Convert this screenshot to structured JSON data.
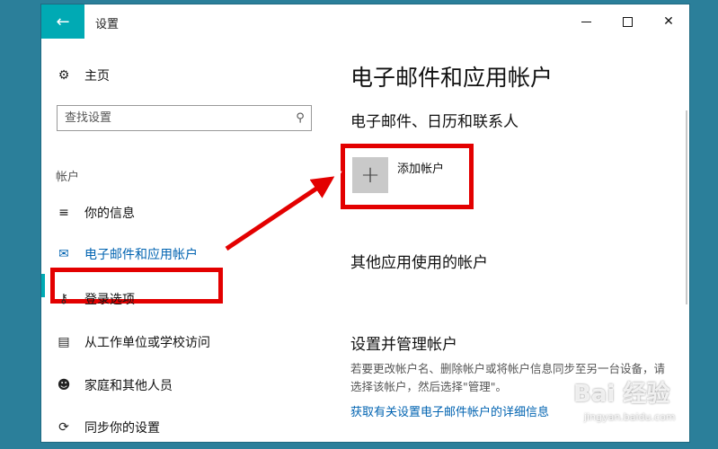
{
  "window": {
    "title": "设置",
    "back_icon": "back-arrow-icon",
    "minimize_icon": "minimize-icon",
    "maximize_icon": "maximize-icon",
    "close_icon": "close-icon",
    "accent": "#00aab4"
  },
  "sidebar": {
    "home_label": "主页",
    "search": {
      "placeholder": "查找设置"
    },
    "section_label": "帐户",
    "items": [
      {
        "label": "你的信息",
        "icon": "person-card-icon"
      },
      {
        "label": "电子邮件和应用帐户",
        "icon": "mail-icon",
        "selected": true
      },
      {
        "label": "登录选项",
        "icon": "key-icon"
      },
      {
        "label": "从工作单位或学校访问",
        "icon": "briefcase-icon"
      },
      {
        "label": "家庭和其他人员",
        "icon": "person-add-icon"
      },
      {
        "label": "同步你的设置",
        "icon": "sync-icon"
      }
    ]
  },
  "main": {
    "page_title": "电子邮件和应用帐户",
    "section1_title": "电子邮件、日历和联系人",
    "add_account_label": "添加帐户",
    "section2_title": "其他应用使用的帐户",
    "section3_title": "设置并管理帐户",
    "section3_desc": "若要更改帐户名、删除帐户或将帐户信息同步至另一台设备，请选择该帐户，然后选择\"管理\"。",
    "section3_link": "获取有关设置电子邮件帐户的详细信息"
  },
  "annotation": {
    "color": "#e30000"
  },
  "watermark": {
    "main": "Bai 经验",
    "sub": "jingyan.baidu.com"
  }
}
